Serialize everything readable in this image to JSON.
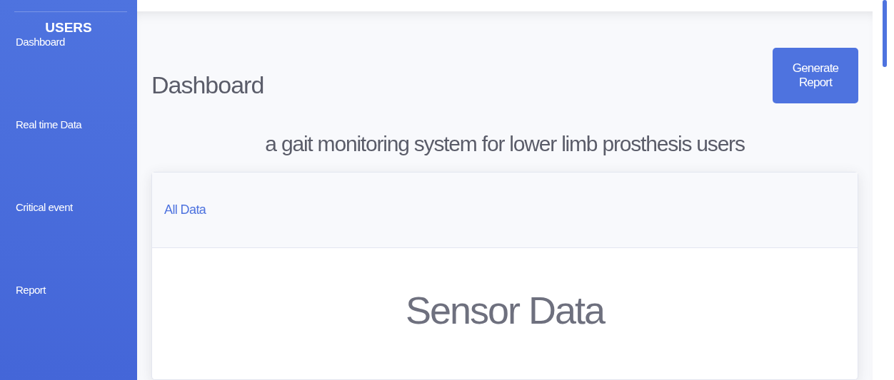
{
  "sidebar": {
    "heading": "USERS",
    "items": [
      {
        "label": "Dashboard"
      },
      {
        "label": "Real time Data"
      },
      {
        "label": "Critical event"
      },
      {
        "label": "Report"
      }
    ]
  },
  "header": {
    "title": "Dashboard",
    "button": "Generate Report"
  },
  "subtitle": "a gait monitoring system for lower limb prosthesis users",
  "card": {
    "header": "All Data",
    "title": "Sensor Data"
  }
}
